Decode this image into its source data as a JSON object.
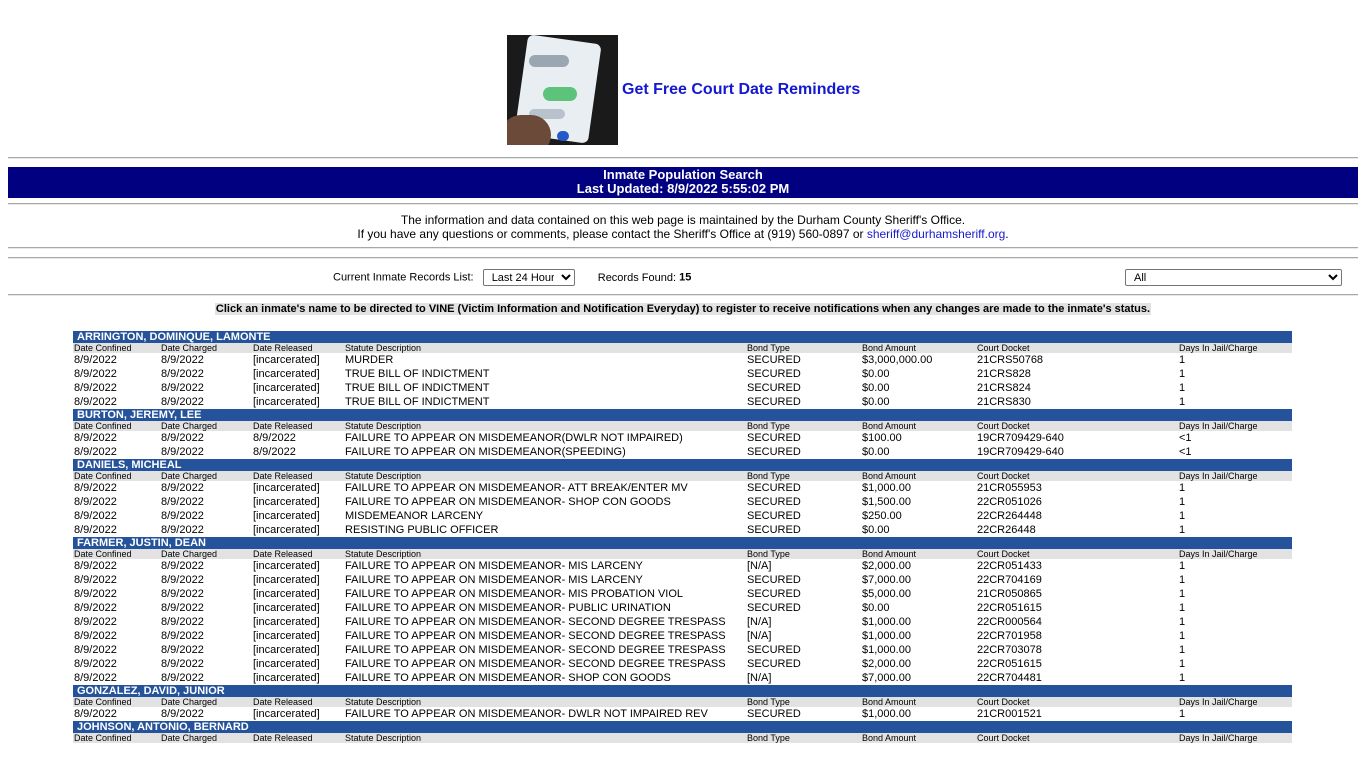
{
  "reminder": {
    "link_text": "Get Free Court Date Reminders"
  },
  "banner": {
    "title": "Inmate Population Search",
    "updated": "Last Updated: 8/9/2022 5:55:02 PM"
  },
  "info": {
    "line1": "The information and data contained on this web page is maintained by the Durham County Sheriff's Office.",
    "line2_prefix": "If you have any questions or comments, please contact the Sheriff's Office at (919) 560-0897 or ",
    "email": "sheriff@durhamsheriff.org",
    "line2_suffix": "."
  },
  "controls": {
    "list_label": "Current Inmate Records List:",
    "list_value": "Last 24 Hours",
    "found_label": "Records Found:",
    "found_value": "15",
    "filter_value": "All"
  },
  "notice": "Click an inmate's name to be directed to VINE (Victim Information and Notification Everyday) to register to receive notifications when any changes are made to the inmate's status.",
  "columns": [
    "Date Confined",
    "Date Charged",
    "Date Released",
    "Statute Description",
    "Bond Type",
    "Bond Amount",
    "Court Docket",
    "Days In Jail/Charge"
  ],
  "inmates": [
    {
      "name": "ARRINGTON, DOMINQUE, LAMONTE",
      "charges": [
        [
          "8/9/2022",
          "8/9/2022",
          "[incarcerated]",
          "MURDER",
          "SECURED",
          "$3,000,000.00",
          "21CRS50768",
          "1"
        ],
        [
          "8/9/2022",
          "8/9/2022",
          "[incarcerated]",
          "TRUE BILL OF INDICTMENT",
          "SECURED",
          "$0.00",
          "21CRS828",
          "1"
        ],
        [
          "8/9/2022",
          "8/9/2022",
          "[incarcerated]",
          "TRUE BILL OF INDICTMENT",
          "SECURED",
          "$0.00",
          "21CRS824",
          "1"
        ],
        [
          "8/9/2022",
          "8/9/2022",
          "[incarcerated]",
          "TRUE BILL OF INDICTMENT",
          "SECURED",
          "$0.00",
          "21CRS830",
          "1"
        ]
      ]
    },
    {
      "name": "BURTON, JEREMY, LEE",
      "charges": [
        [
          "8/9/2022",
          "8/9/2022",
          "8/9/2022",
          "FAILURE TO APPEAR ON MISDEMEANOR(DWLR NOT IMPAIRED)",
          "SECURED",
          "$100.00",
          "19CR709429-640",
          "<1"
        ],
        [
          "8/9/2022",
          "8/9/2022",
          "8/9/2022",
          "FAILURE TO APPEAR ON MISDEMEANOR(SPEEDING)",
          "SECURED",
          "$0.00",
          "19CR709429-640",
          "<1"
        ]
      ]
    },
    {
      "name": "DANIELS, MICHEAL",
      "charges": [
        [
          "8/9/2022",
          "8/9/2022",
          "[incarcerated]",
          "FAILURE TO APPEAR ON MISDEMEANOR- ATT BREAK/ENTER MV",
          "SECURED",
          "$1,000.00",
          "21CR055953",
          "1"
        ],
        [
          "8/9/2022",
          "8/9/2022",
          "[incarcerated]",
          "FAILURE TO APPEAR ON MISDEMEANOR- SHOP CON GOODS",
          "SECURED",
          "$1,500.00",
          "22CR051026",
          "1"
        ],
        [
          "8/9/2022",
          "8/9/2022",
          "[incarcerated]",
          "MISDEMEANOR LARCENY",
          "SECURED",
          "$250.00",
          "22CR264448",
          "1"
        ],
        [
          "8/9/2022",
          "8/9/2022",
          "[incarcerated]",
          "RESISTING PUBLIC OFFICER",
          "SECURED",
          "$0.00",
          "22CR26448",
          "1"
        ]
      ]
    },
    {
      "name": "FARMER, JUSTIN, DEAN",
      "charges": [
        [
          "8/9/2022",
          "8/9/2022",
          "[incarcerated]",
          "FAILURE TO APPEAR ON MISDEMEANOR- MIS LARCENY",
          "[N/A]",
          "$2,000.00",
          "22CR051433",
          "1"
        ],
        [
          "8/9/2022",
          "8/9/2022",
          "[incarcerated]",
          "FAILURE TO APPEAR ON MISDEMEANOR- MIS LARCENY",
          "SECURED",
          "$7,000.00",
          "22CR704169",
          "1"
        ],
        [
          "8/9/2022",
          "8/9/2022",
          "[incarcerated]",
          "FAILURE TO APPEAR ON MISDEMEANOR- MIS PROBATION VIOL",
          "SECURED",
          "$5,000.00",
          "21CR050865",
          "1"
        ],
        [
          "8/9/2022",
          "8/9/2022",
          "[incarcerated]",
          "FAILURE TO APPEAR ON MISDEMEANOR- PUBLIC URINATION",
          "SECURED",
          "$0.00",
          "22CR051615",
          "1"
        ],
        [
          "8/9/2022",
          "8/9/2022",
          "[incarcerated]",
          "FAILURE TO APPEAR ON MISDEMEANOR- SECOND DEGREE TRESPASS",
          "[N/A]",
          "$1,000.00",
          "22CR000564",
          "1"
        ],
        [
          "8/9/2022",
          "8/9/2022",
          "[incarcerated]",
          "FAILURE TO APPEAR ON MISDEMEANOR- SECOND DEGREE TRESPASS",
          "[N/A]",
          "$1,000.00",
          "22CR701958",
          "1"
        ],
        [
          "8/9/2022",
          "8/9/2022",
          "[incarcerated]",
          "FAILURE TO APPEAR ON MISDEMEANOR- SECOND DEGREE TRESPASS",
          "SECURED",
          "$1,000.00",
          "22CR703078",
          "1"
        ],
        [
          "8/9/2022",
          "8/9/2022",
          "[incarcerated]",
          "FAILURE TO APPEAR ON MISDEMEANOR- SECOND DEGREE TRESPASS",
          "SECURED",
          "$2,000.00",
          "22CR051615",
          "1"
        ],
        [
          "8/9/2022",
          "8/9/2022",
          "[incarcerated]",
          "FAILURE TO APPEAR ON MISDEMEANOR- SHOP CON GOODS",
          "[N/A]",
          "$7,000.00",
          "22CR704481",
          "1"
        ]
      ]
    },
    {
      "name": "GONZALEZ, DAVID, JUNIOR",
      "charges": [
        [
          "8/9/2022",
          "8/9/2022",
          "[incarcerated]",
          "FAILURE TO APPEAR ON MISDEMEANOR- DWLR NOT IMPAIRED REV",
          "SECURED",
          "$1,000.00",
          "21CR001521",
          "1"
        ]
      ]
    },
    {
      "name": "JOHNSON, ANTONIO, BERNARD",
      "charges": []
    }
  ]
}
